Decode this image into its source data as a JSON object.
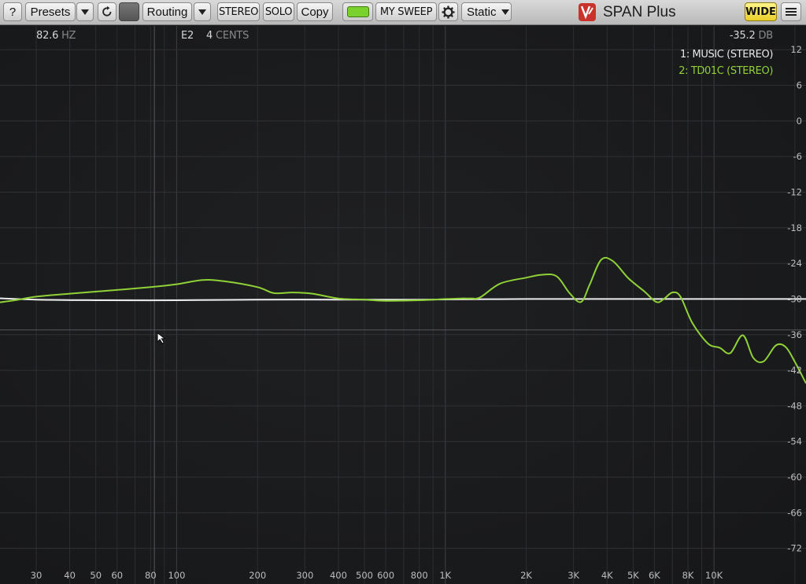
{
  "toolbar": {
    "help_label": "?",
    "presets_label": "Presets",
    "routing_label": "Routing",
    "stereo_label": "STEREO",
    "solo_label": "SOLO",
    "copy_label": "Copy",
    "sweep_label": "MY SWEEP",
    "mode_label": "Static",
    "app_title": "SPAN Plus",
    "wide_label": "WIDE",
    "led_color": "#7bd12c"
  },
  "readout": {
    "freq_value": "82.6",
    "freq_unit": "HZ",
    "note": "E2",
    "cents_value": "4",
    "cents_unit": "CENTS",
    "level_value": "-35.2",
    "level_unit": "DB"
  },
  "legend": [
    {
      "label": "1: MUSIC (STEREO)",
      "color": "#e8e8e8"
    },
    {
      "label": "2: TD01C (STEREO)",
      "color": "#93cf3a"
    }
  ],
  "chart_data": {
    "type": "line",
    "xscale": "log",
    "xlim": [
      22,
      22000
    ],
    "ylim": [
      -78,
      16
    ],
    "x_ticks": [
      {
        "v": 30,
        "label": "30"
      },
      {
        "v": 40,
        "label": "40"
      },
      {
        "v": 50,
        "label": "50"
      },
      {
        "v": 60,
        "label": "60"
      },
      {
        "v": 80,
        "label": "80"
      },
      {
        "v": 100,
        "label": "100"
      },
      {
        "v": 200,
        "label": "200"
      },
      {
        "v": 300,
        "label": "300"
      },
      {
        "v": 400,
        "label": "400"
      },
      {
        "v": 500,
        "label": "500"
      },
      {
        "v": 600,
        "label": "600"
      },
      {
        "v": 800,
        "label": "800"
      },
      {
        "v": 1000,
        "label": "1K"
      },
      {
        "v": 2000,
        "label": "2K"
      },
      {
        "v": 3000,
        "label": "3K"
      },
      {
        "v": 4000,
        "label": "4K"
      },
      {
        "v": 5000,
        "label": "5K"
      },
      {
        "v": 6000,
        "label": "6K"
      },
      {
        "v": 8000,
        "label": "8K"
      },
      {
        "v": 10000,
        "label": "10K"
      }
    ],
    "y_ticks": [
      12,
      6,
      0,
      -6,
      -12,
      -18,
      -24,
      -30,
      -36,
      -42,
      -48,
      -54,
      -60,
      -66,
      -72
    ],
    "cursor_x": 82.6,
    "cursor_y": -35.2,
    "series": [
      {
        "name": "1: MUSIC (STEREO)",
        "color": "#ececec",
        "x": [
          20,
          30,
          50,
          100,
          200,
          400,
          800,
          2000,
          5000,
          10000,
          25000
        ],
        "y": [
          -29.8,
          -30.1,
          -30.2,
          -30.2,
          -30.1,
          -30.1,
          -30.1,
          -30.0,
          -30.0,
          -30.0,
          -30.0
        ]
      },
      {
        "name": "2: TD01C (STEREO)",
        "color": "#8fd136",
        "x": [
          20,
          25,
          30,
          40,
          55,
          80,
          100,
          125,
          150,
          200,
          230,
          270,
          320,
          400,
          500,
          600,
          800,
          1000,
          1150,
          1250,
          1350,
          1600,
          2000,
          2300,
          2600,
          2900,
          3200,
          3450,
          3800,
          4200,
          4800,
          5500,
          6100,
          6500,
          7000,
          7500,
          8300,
          9500,
          10500,
          11500,
          12800,
          14000,
          15300,
          17000,
          18500,
          20000,
          22000
        ],
        "y": [
          -30.8,
          -30.2,
          -29.6,
          -29.1,
          -28.6,
          -28.0,
          -27.5,
          -26.8,
          -27.0,
          -28.0,
          -29.0,
          -28.9,
          -29.1,
          -29.9,
          -30.1,
          -30.3,
          -30.2,
          -30.0,
          -29.9,
          -29.9,
          -29.7,
          -27.4,
          -26.4,
          -25.9,
          -26.2,
          -29.0,
          -30.5,
          -27.5,
          -23.4,
          -23.6,
          -26.5,
          -28.7,
          -30.5,
          -30.0,
          -28.9,
          -29.6,
          -34.0,
          -37.5,
          -38.2,
          -39.1,
          -36.1,
          -39.9,
          -40.5,
          -37.8,
          -38.1,
          -40.6,
          -44.2
        ]
      }
    ]
  }
}
